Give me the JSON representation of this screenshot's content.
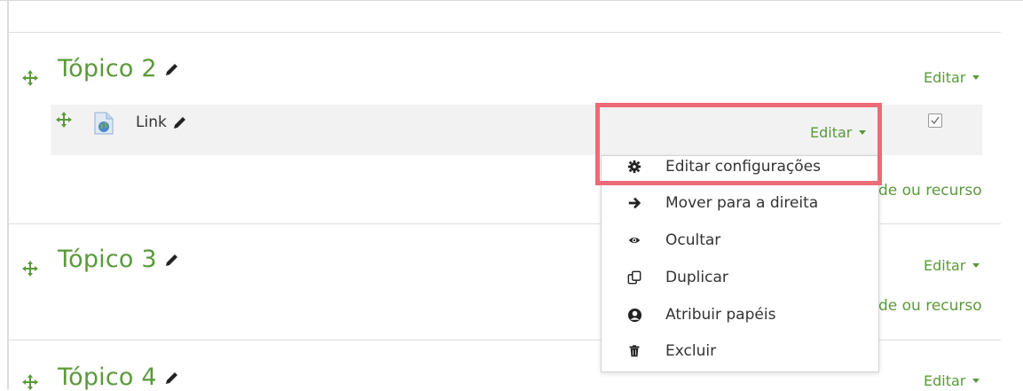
{
  "sections": [
    {
      "title": "Tópico 2",
      "edit_label": "Editar"
    },
    {
      "title": "Tópico 3",
      "edit_label": "Editar"
    },
    {
      "title": "Tópico 4",
      "edit_label": "Editar"
    }
  ],
  "activity": {
    "name": "Link",
    "edit_label": "Editar"
  },
  "add_activity_text": "de ou recurso",
  "menu": {
    "items": [
      {
        "label": "Editar configurações",
        "icon": "gear-icon"
      },
      {
        "label": "Mover para a direita",
        "icon": "arrow-right-icon"
      },
      {
        "label": "Ocultar",
        "icon": "eye-icon"
      },
      {
        "label": "Duplicar",
        "icon": "duplicate-icon"
      },
      {
        "label": "Atribuir papéis",
        "icon": "user-icon"
      },
      {
        "label": "Excluir",
        "icon": "trash-icon"
      }
    ]
  },
  "colors": {
    "accent": "#5a9a3a",
    "highlight": "#ec6b77",
    "row_bg": "#f2f2f2"
  }
}
